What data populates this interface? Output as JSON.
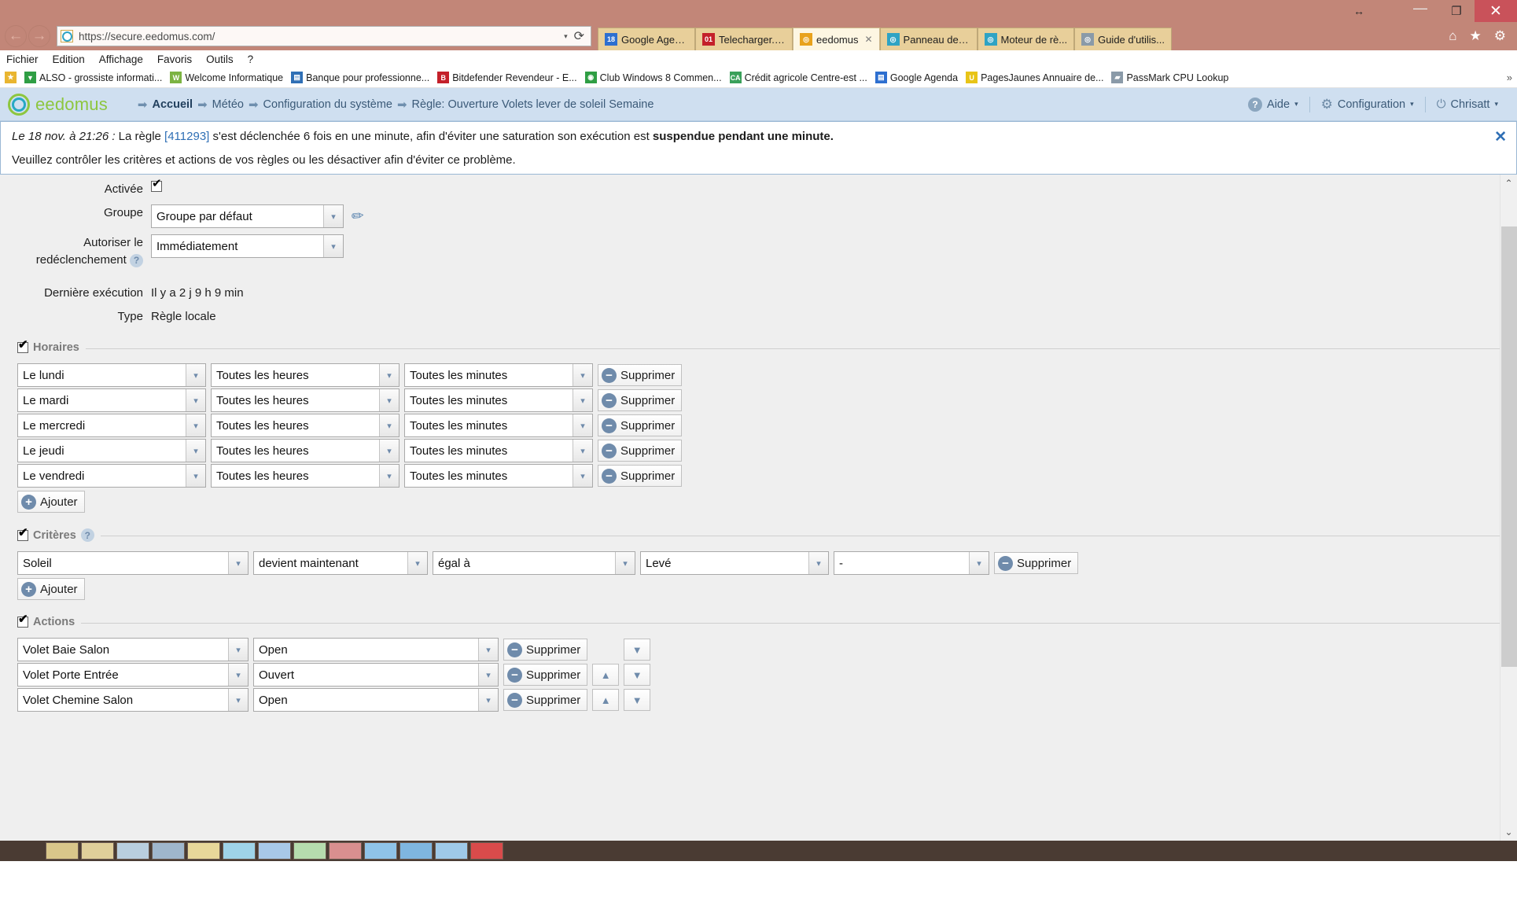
{
  "window": {
    "resize_glyph": "↔",
    "minimize": "—",
    "maximize": "❐",
    "close": "✕"
  },
  "browser": {
    "back_label": "←",
    "forward_label": "→",
    "url": "https://secure.eedomus.com/",
    "url_dropdown_caret": "▾",
    "reload_label": "⟳",
    "home_icon": "⌂",
    "favorites_icon": "★",
    "settings_icon": "⚙",
    "tabs": [
      {
        "label": "Google Agen...",
        "icon_text": "18",
        "icon_color": "#2d6fd0",
        "active": false,
        "closable": false
      },
      {
        "label": "Telecharger.c...",
        "icon_text": "01",
        "icon_color": "#c4202a",
        "active": false,
        "closable": false
      },
      {
        "label": "eedomus",
        "icon_text": "◎",
        "icon_color": "#e8a21c",
        "active": true,
        "closable": true,
        "close_label": "✕"
      },
      {
        "label": "Panneau de c...",
        "icon_text": "◎",
        "icon_color": "#2fa3c4",
        "active": false,
        "closable": false
      },
      {
        "label": "Moteur de rè...",
        "icon_text": "◎",
        "icon_color": "#2fa3c4",
        "active": false,
        "closable": false
      },
      {
        "label": "Guide d'utilis...",
        "icon_text": "◎",
        "icon_color": "#8a9aa8",
        "active": false,
        "closable": false
      }
    ],
    "menu": [
      "Fichier",
      "Edition",
      "Affichage",
      "Favoris",
      "Outils",
      "?"
    ],
    "bookmarks_overflow": "»",
    "bookmarks": [
      {
        "label": "",
        "icon_text": "★",
        "icon_color": "#e9b530"
      },
      {
        "label": "ALSO - grossiste informati...",
        "icon_text": "▼",
        "icon_color": "#2f9e44"
      },
      {
        "label": "Welcome Informatique",
        "icon_text": "W",
        "icon_color": "#7cb342"
      },
      {
        "label": "Banque pour professionne...",
        "icon_text": "▤",
        "icon_color": "#2f6fb5"
      },
      {
        "label": "Bitdefender Revendeur - E...",
        "icon_text": "B",
        "icon_color": "#c4202a"
      },
      {
        "label": "Club Windows 8 Commen...",
        "icon_text": "◉",
        "icon_color": "#2f9e44"
      },
      {
        "label": "Crédit agricole Centre-est ...",
        "icon_text": "CA",
        "icon_color": "#3aa05a"
      },
      {
        "label": "Google Agenda",
        "icon_text": "▤",
        "icon_color": "#2d6fd0"
      },
      {
        "label": "PagesJaunes  Annuaire de...",
        "icon_text": "U",
        "icon_color": "#e8c417"
      },
      {
        "label": "PassMark CPU Lookup",
        "icon_text": "▰",
        "icon_color": "#8a9aa8"
      }
    ]
  },
  "app": {
    "logo_text": "eedomus",
    "breadcrumbs": [
      {
        "label": "Accueil",
        "current": true
      },
      {
        "label": "Météo",
        "current": false
      },
      {
        "label": "Configuration du système",
        "current": false
      },
      {
        "label": "Règle: Ouverture Volets lever de soleil Semaine",
        "current": false
      }
    ],
    "breadcrumb_arrow": "➡",
    "header_menu": [
      {
        "label": "Aide",
        "icon": "question-icon",
        "glyph": "?"
      },
      {
        "label": "Configuration",
        "icon": "gear-icon",
        "glyph": "⚙"
      },
      {
        "label": "Chrisatt",
        "icon": "power-icon",
        "glyph": "⏻"
      }
    ],
    "caret": "▾"
  },
  "alert": {
    "timestamp": "Le 18 nov. à 21:26 : ",
    "text_before_link": "La règle ",
    "rule_id": "[411293]",
    "text_after_link": " s'est déclenchée 6 fois en une minute, afin d'éviter une saturation son exécution est ",
    "bold_tail": "suspendue pendant une minute.",
    "second_line": "Veuillez contrôler les critères et actions de vos règles ou les désactiver afin d'éviter ce problème.",
    "close_label": "✕"
  },
  "form": {
    "enabled_label": "Activée",
    "enabled_checked": true,
    "group_label": "Groupe",
    "group_value": "Groupe par défaut",
    "retrigger_label_line1": "Autoriser le",
    "retrigger_label_line2": "redéclenchement",
    "retrigger_value": "Immédiatement",
    "retrigger_help": "?",
    "last_exec_label": "Dernière exécution",
    "last_exec_value": "Il y a 2 j 9 h 9 min",
    "type_label": "Type",
    "type_value": "Règle locale",
    "select_caret": "▾",
    "edit_icon": "✏"
  },
  "schedules": {
    "legend": "Horaires",
    "checked": true,
    "add_label": "Ajouter",
    "delete_label": "Supprimer",
    "rows": [
      {
        "day": "Le lundi",
        "hours": "Toutes les heures",
        "minutes": "Toutes les minutes"
      },
      {
        "day": "Le mardi",
        "hours": "Toutes les heures",
        "minutes": "Toutes les minutes"
      },
      {
        "day": "Le mercredi",
        "hours": "Toutes les heures",
        "minutes": "Toutes les minutes"
      },
      {
        "day": "Le jeudi",
        "hours": "Toutes les heures",
        "minutes": "Toutes les minutes"
      },
      {
        "day": "Le vendredi",
        "hours": "Toutes les heures",
        "minutes": "Toutes les minutes"
      }
    ]
  },
  "criteria": {
    "legend": "Critères",
    "checked": true,
    "help": "?",
    "add_label": "Ajouter",
    "delete_label": "Supprimer",
    "rows": [
      {
        "source": "Soleil",
        "event": "devient maintenant",
        "operator": "égal à",
        "value": "Levé",
        "extra": "-"
      }
    ]
  },
  "actions": {
    "legend": "Actions",
    "checked": true,
    "delete_label": "Supprimer",
    "up_label": "▲",
    "down_label": "▼",
    "rows": [
      {
        "device": "Volet Baie Salon",
        "command": "Open",
        "has_up": false,
        "has_down": true
      },
      {
        "device": "Volet Porte Entrée",
        "command": "Ouvert",
        "has_up": true,
        "has_down": true
      },
      {
        "device": "Volet Chemine Salon",
        "command": "Open",
        "has_up": true,
        "has_down": true
      }
    ]
  },
  "scrollbar": {
    "up_label": "⌃",
    "down_label": "⌄"
  }
}
